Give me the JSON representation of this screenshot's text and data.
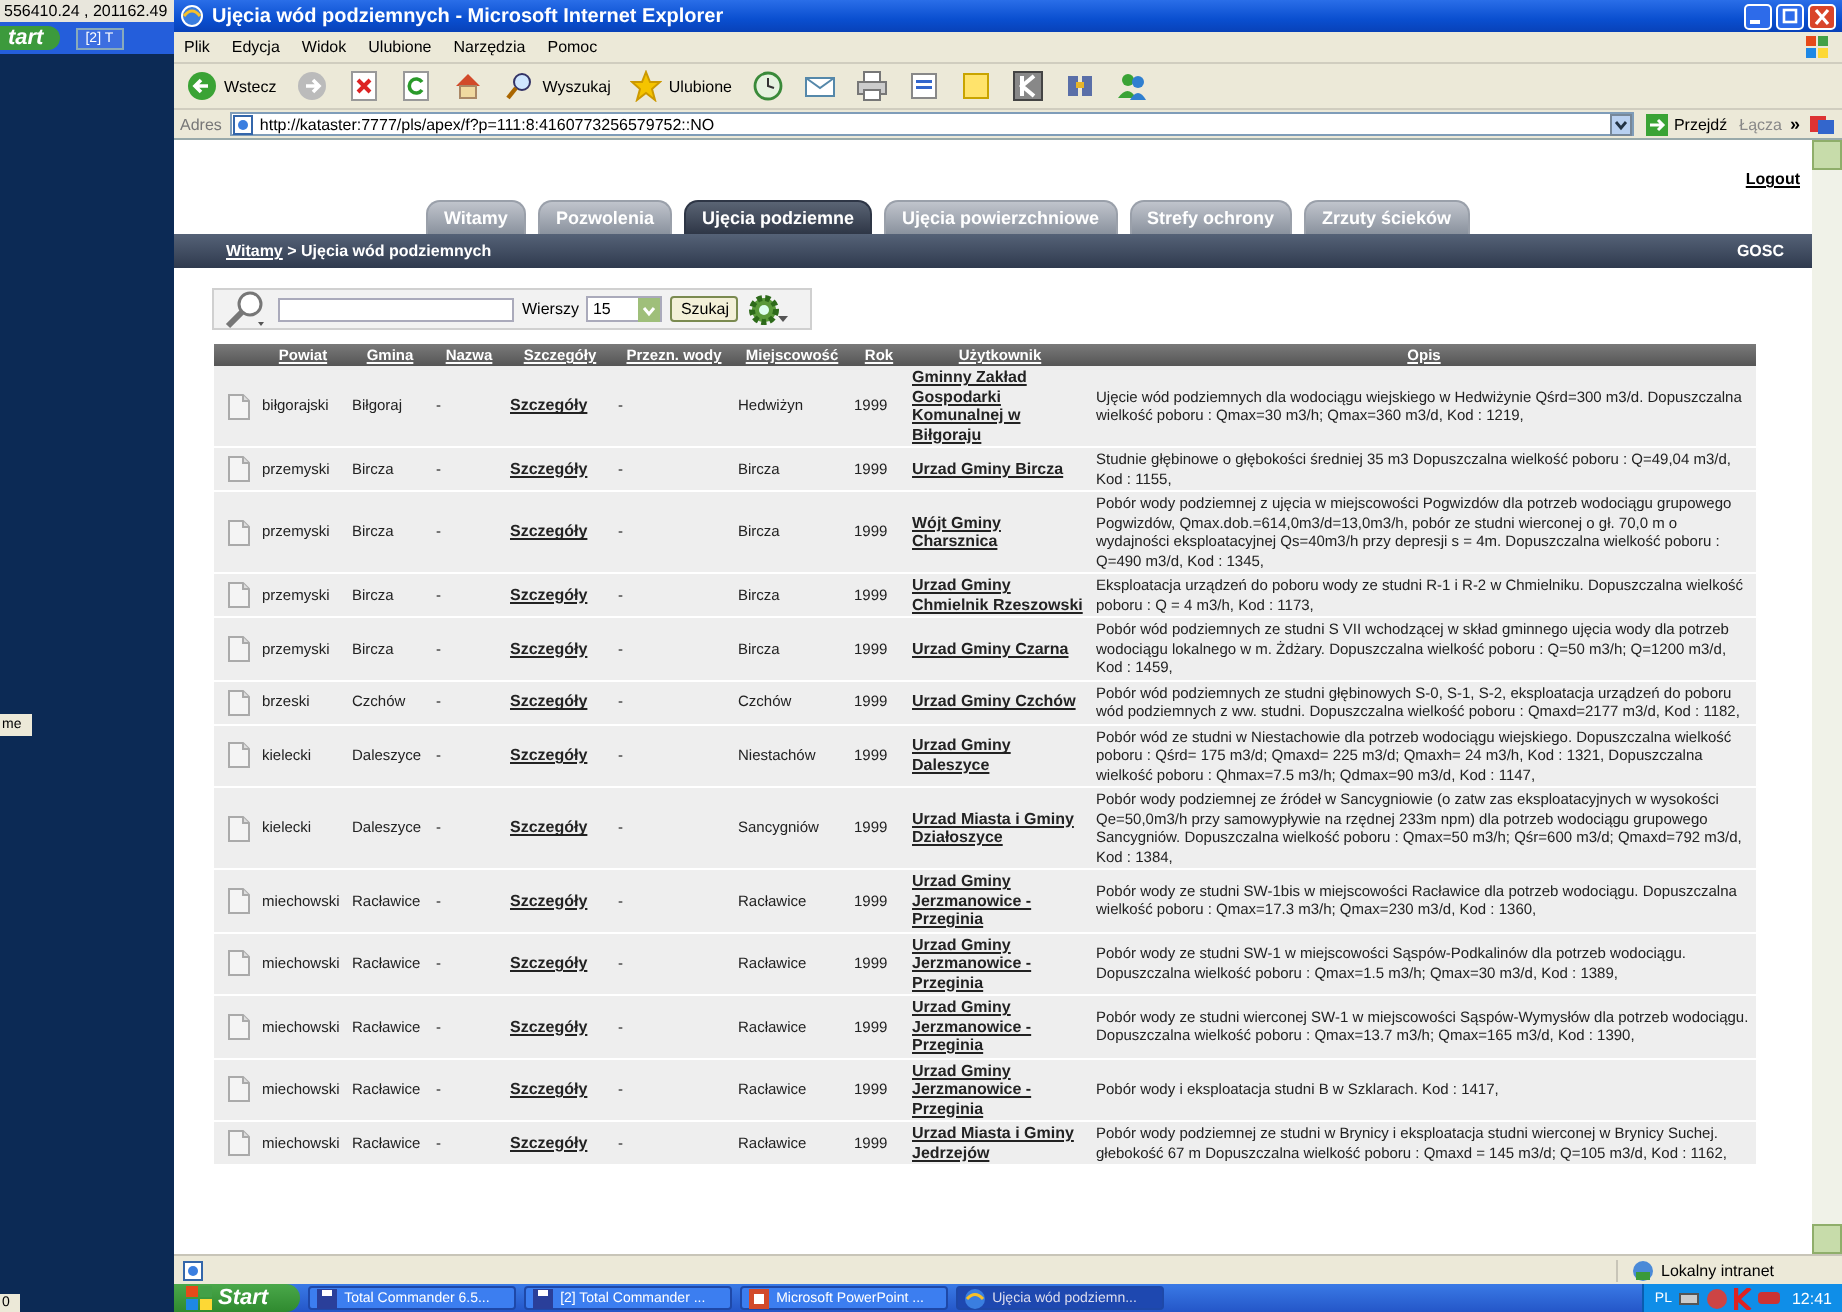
{
  "desktop": {
    "coordinates": "556410.24 , 201162.49",
    "start_fragment": "tart",
    "task_fragment": "[2] T",
    "side_fragment": "me",
    "corner_fragment": "0"
  },
  "window": {
    "title": "Ujęcia wód podziemnych - Microsoft Internet Explorer"
  },
  "menu": [
    "Plik",
    "Edycja",
    "Widok",
    "Ulubione",
    "Narzędzia",
    "Pomoc"
  ],
  "toolbar": [
    {
      "kind": "back",
      "label": "Wstecz"
    },
    {
      "kind": "forward"
    },
    {
      "kind": "stop"
    },
    {
      "kind": "refresh"
    },
    {
      "kind": "home"
    },
    {
      "kind": "search",
      "label": "Wyszukaj"
    },
    {
      "kind": "favorites",
      "label": "Ulubione"
    },
    {
      "kind": "history"
    },
    {
      "kind": "mail"
    },
    {
      "kind": "print"
    },
    {
      "kind": "edit"
    },
    {
      "kind": "note"
    },
    {
      "kind": "k"
    },
    {
      "kind": "tool"
    },
    {
      "kind": "people"
    }
  ],
  "address": {
    "label": "Adres",
    "value": "http://kataster:7777/pls/apex/f?p=111:8:4160773256579752::NO",
    "go": "Przejdź",
    "links": "Łącza",
    "more": "»"
  },
  "page": {
    "logout": "Logout",
    "tabs": [
      {
        "label": "Witamy",
        "selected": false
      },
      {
        "label": "Pozwolenia",
        "selected": false
      },
      {
        "label": "Ujęcia podziemne",
        "selected": true
      },
      {
        "label": "Ujęcia powierzchniowe",
        "selected": false
      },
      {
        "label": "Strefy ochrony",
        "selected": false
      },
      {
        "label": "Zrzuty ścieków",
        "selected": false
      }
    ],
    "breadcrumb": {
      "link": "Witamy",
      "rest": " > Ujęcia wód podziemnych"
    },
    "user": "GOSC",
    "search": {
      "rows_label": "Wierszy",
      "rows_value": "15",
      "button": "Szukaj"
    },
    "table": {
      "columns": [
        "Powiat",
        "Gmina",
        "Nazwa",
        "Szczegóły",
        "Przezn. wody",
        "Miejscowość",
        "Rok",
        "Użytkownik",
        "Opis"
      ],
      "rows": [
        {
          "powiat": "biłgorajski",
          "gmina": "Biłgoraj",
          "nazwa": "-",
          "szczegoly": "Szczegóły",
          "przezn": "-",
          "miejscowosc": "Hedwiżyn",
          "rok": "1999",
          "uzytkownik": "Gminny Zakład Gospodarki Komunalnej w Biłgoraju",
          "opis": "Ujęcie wód podziemnych dla wodociągu wiejskiego w Hedwiżynie Qśrd=300 m3/d. Dopuszczalna wielkość poboru : Qmax=30 m3/h; Qmax=360 m3/d, Kod : 1219,"
        },
        {
          "powiat": "przemyski",
          "gmina": "Bircza",
          "nazwa": "-",
          "szczegoly": "Szczegóły",
          "przezn": "-",
          "miejscowosc": "Bircza",
          "rok": "1999",
          "uzytkownik": "Urzad Gminy Bircza",
          "opis": "Studnie głębinowe o głębokości średniej 35 m3 Dopuszczalna wielkość poboru : Q=49,04 m3/d, Kod : 1155,"
        },
        {
          "powiat": "przemyski",
          "gmina": "Bircza",
          "nazwa": "-",
          "szczegoly": "Szczegóły",
          "przezn": "-",
          "miejscowosc": "Bircza",
          "rok": "1999",
          "uzytkownik": "Wójt Gminy Charsznica",
          "opis": "Pobór wody podziemnej z ujęcia w miejscowości Pogwizdów dla potrzeb wodociągu grupowego Pogwizdów, Qmax.dob.=614,0m3/d=13,0m3/h, pobór ze studni wierconej o gł. 70,0 m o wydajności eksploatacyjnej Qs=40m3/h przy depresji s = 4m. Dopuszczalna wielkość poboru : Q=490 m3/d, Kod : 1345,"
        },
        {
          "powiat": "przemyski",
          "gmina": "Bircza",
          "nazwa": "-",
          "szczegoly": "Szczegóły",
          "przezn": "-",
          "miejscowosc": "Bircza",
          "rok": "1999",
          "uzytkownik": "Urzad Gminy Chmielnik Rzeszowski",
          "opis": "Eksploatacja urządzeń do poboru wody ze studni R-1 i R-2 w Chmielniku. Dopuszczalna wielkość poboru : Q = 4 m3/h, Kod : 1173,"
        },
        {
          "powiat": "przemyski",
          "gmina": "Bircza",
          "nazwa": "-",
          "szczegoly": "Szczegóły",
          "przezn": "-",
          "miejscowosc": "Bircza",
          "rok": "1999",
          "uzytkownik": "Urzad Gminy Czarna",
          "opis": "Pobór wód podziemnych ze studni S VII wchodzącej w skład gminnego ujęcia wody dla potrzeb wodociągu lokalnego w m. Żdżary. Dopuszczalna wielkość poboru : Q=50 m3/h; Q=1200 m3/d, Kod : 1459,"
        },
        {
          "powiat": "brzeski",
          "gmina": "Czchów",
          "nazwa": "-",
          "szczegoly": "Szczegóły",
          "przezn": "-",
          "miejscowosc": "Czchów",
          "rok": "1999",
          "uzytkownik": "Urzad Gminy Czchów",
          "opis": "Pobór wód podziemnych ze studni głębinowych S-0, S-1, S-2, eksploatacja urządzeń do poboru wód podziemnych z ww. studni. Dopuszczalna wielkość poboru : Qmaxd=2177 m3/d, Kod : 1182,"
        },
        {
          "powiat": "kielecki",
          "gmina": "Daleszyce",
          "nazwa": "-",
          "szczegoly": "Szczegóły",
          "przezn": "-",
          "miejscowosc": "Niestachów",
          "rok": "1999",
          "uzytkownik": "Urzad Gminy Daleszyce",
          "opis": "Pobór wód ze studni w Niestachowie dla potrzeb wodociągu wiejskiego. Dopuszczalna wielkość poboru : Qśrd= 175 m3/d; Qmaxd= 225 m3/d; Qmaxh= 24 m3/h, Kod : 1321, Dopuszczalna wielkość poboru : Qhmax=7.5 m3/h; Qdmax=90 m3/d, Kod : 1147,"
        },
        {
          "powiat": "kielecki",
          "gmina": "Daleszyce",
          "nazwa": "-",
          "szczegoly": "Szczegóły",
          "przezn": "-",
          "miejscowosc": "Sancygniów",
          "rok": "1999",
          "uzytkownik": "Urzad Miasta i Gminy Działoszyce",
          "opis": "Pobór wody podziemnej ze źródeł w Sancygniowie (o zatw zas eksploatacyjnych w wysokości Qe=50,0m3/h przy samowypływie na rzędnej 233m npm) dla potrzeb wodociągu grupowego Sancygniów. Dopuszczalna wielkość poboru : Qmax=50 m3/h; Qśr=600 m3/d; Qmaxd=792 m3/d, Kod : 1384,"
        },
        {
          "powiat": "miechowski",
          "gmina": "Racławice",
          "nazwa": "-",
          "szczegoly": "Szczegóły",
          "przezn": "-",
          "miejscowosc": "Racławice",
          "rok": "1999",
          "uzytkownik": "Urzad Gminy Jerzmanowice - Przeginia",
          "opis": "Pobór wody ze studni SW-1bis w miejscowości Racławice dla potrzeb wodociągu. Dopuszczalna wielkość poboru : Qmax=17.3 m3/h; Qmax=230 m3/d, Kod : 1360,"
        },
        {
          "powiat": "miechowski",
          "gmina": "Racławice",
          "nazwa": "-",
          "szczegoly": "Szczegóły",
          "przezn": "-",
          "miejscowosc": "Racławice",
          "rok": "1999",
          "uzytkownik": "Urzad Gminy Jerzmanowice - Przeginia",
          "opis": "Pobór wody ze studni SW-1 w miejscowości Sąspów-Podkalinów dla potrzeb wodociągu. Dopuszczalna wielkość poboru : Qmax=1.5 m3/h; Qmax=30 m3/d, Kod : 1389,"
        },
        {
          "powiat": "miechowski",
          "gmina": "Racławice",
          "nazwa": "-",
          "szczegoly": "Szczegóły",
          "przezn": "-",
          "miejscowosc": "Racławice",
          "rok": "1999",
          "uzytkownik": "Urzad Gminy Jerzmanowice - Przeginia",
          "opis": "Pobór wody ze studni wierconej SW-1 w miejscowości Sąspów-Wymysłów dla potrzeb wodociągu. Dopuszczalna wielkość poboru : Qmax=13.7 m3/h; Qmax=165 m3/d, Kod : 1390,"
        },
        {
          "powiat": "miechowski",
          "gmina": "Racławice",
          "nazwa": "-",
          "szczegoly": "Szczegóły",
          "przezn": "-",
          "miejscowosc": "Racławice",
          "rok": "1999",
          "uzytkownik": "Urzad Gminy Jerzmanowice - Przeginia",
          "opis": "Pobór wody i eksploatacja studni B w Szklarach. Kod : 1417,"
        },
        {
          "powiat": "miechowski",
          "gmina": "Racławice",
          "nazwa": "-",
          "szczegoly": "Szczegóły",
          "przezn": "-",
          "miejscowosc": "Racławice",
          "rok": "1999",
          "uzytkownik": "Urzad Miasta i Gminy Jedrzejów",
          "opis": "Pobór wody podziemnej ze studni w Brynicy i eksploatacja studni wierconej w Brynicy Suchej. głebokość 67 m Dopuszczalna wielkość poboru : Qmaxd = 145 m3/d; Q=105 m3/d, Kod : 1162,"
        }
      ]
    }
  },
  "status_bar": {
    "zone": "Lokalny intranet"
  },
  "taskbar": {
    "start": "Start",
    "tasks": [
      {
        "label": "Total Commander 6.5...",
        "kind": "disk",
        "selected": false
      },
      {
        "label": "[2] Total Commander ...",
        "kind": "disk",
        "selected": false
      },
      {
        "label": "Microsoft PowerPoint ...",
        "kind": "slides",
        "selected": false
      },
      {
        "label": "Ujęcia wód podziemn...",
        "kind": "browser",
        "selected": true
      }
    ],
    "language": "PL",
    "clock": "12:41"
  }
}
